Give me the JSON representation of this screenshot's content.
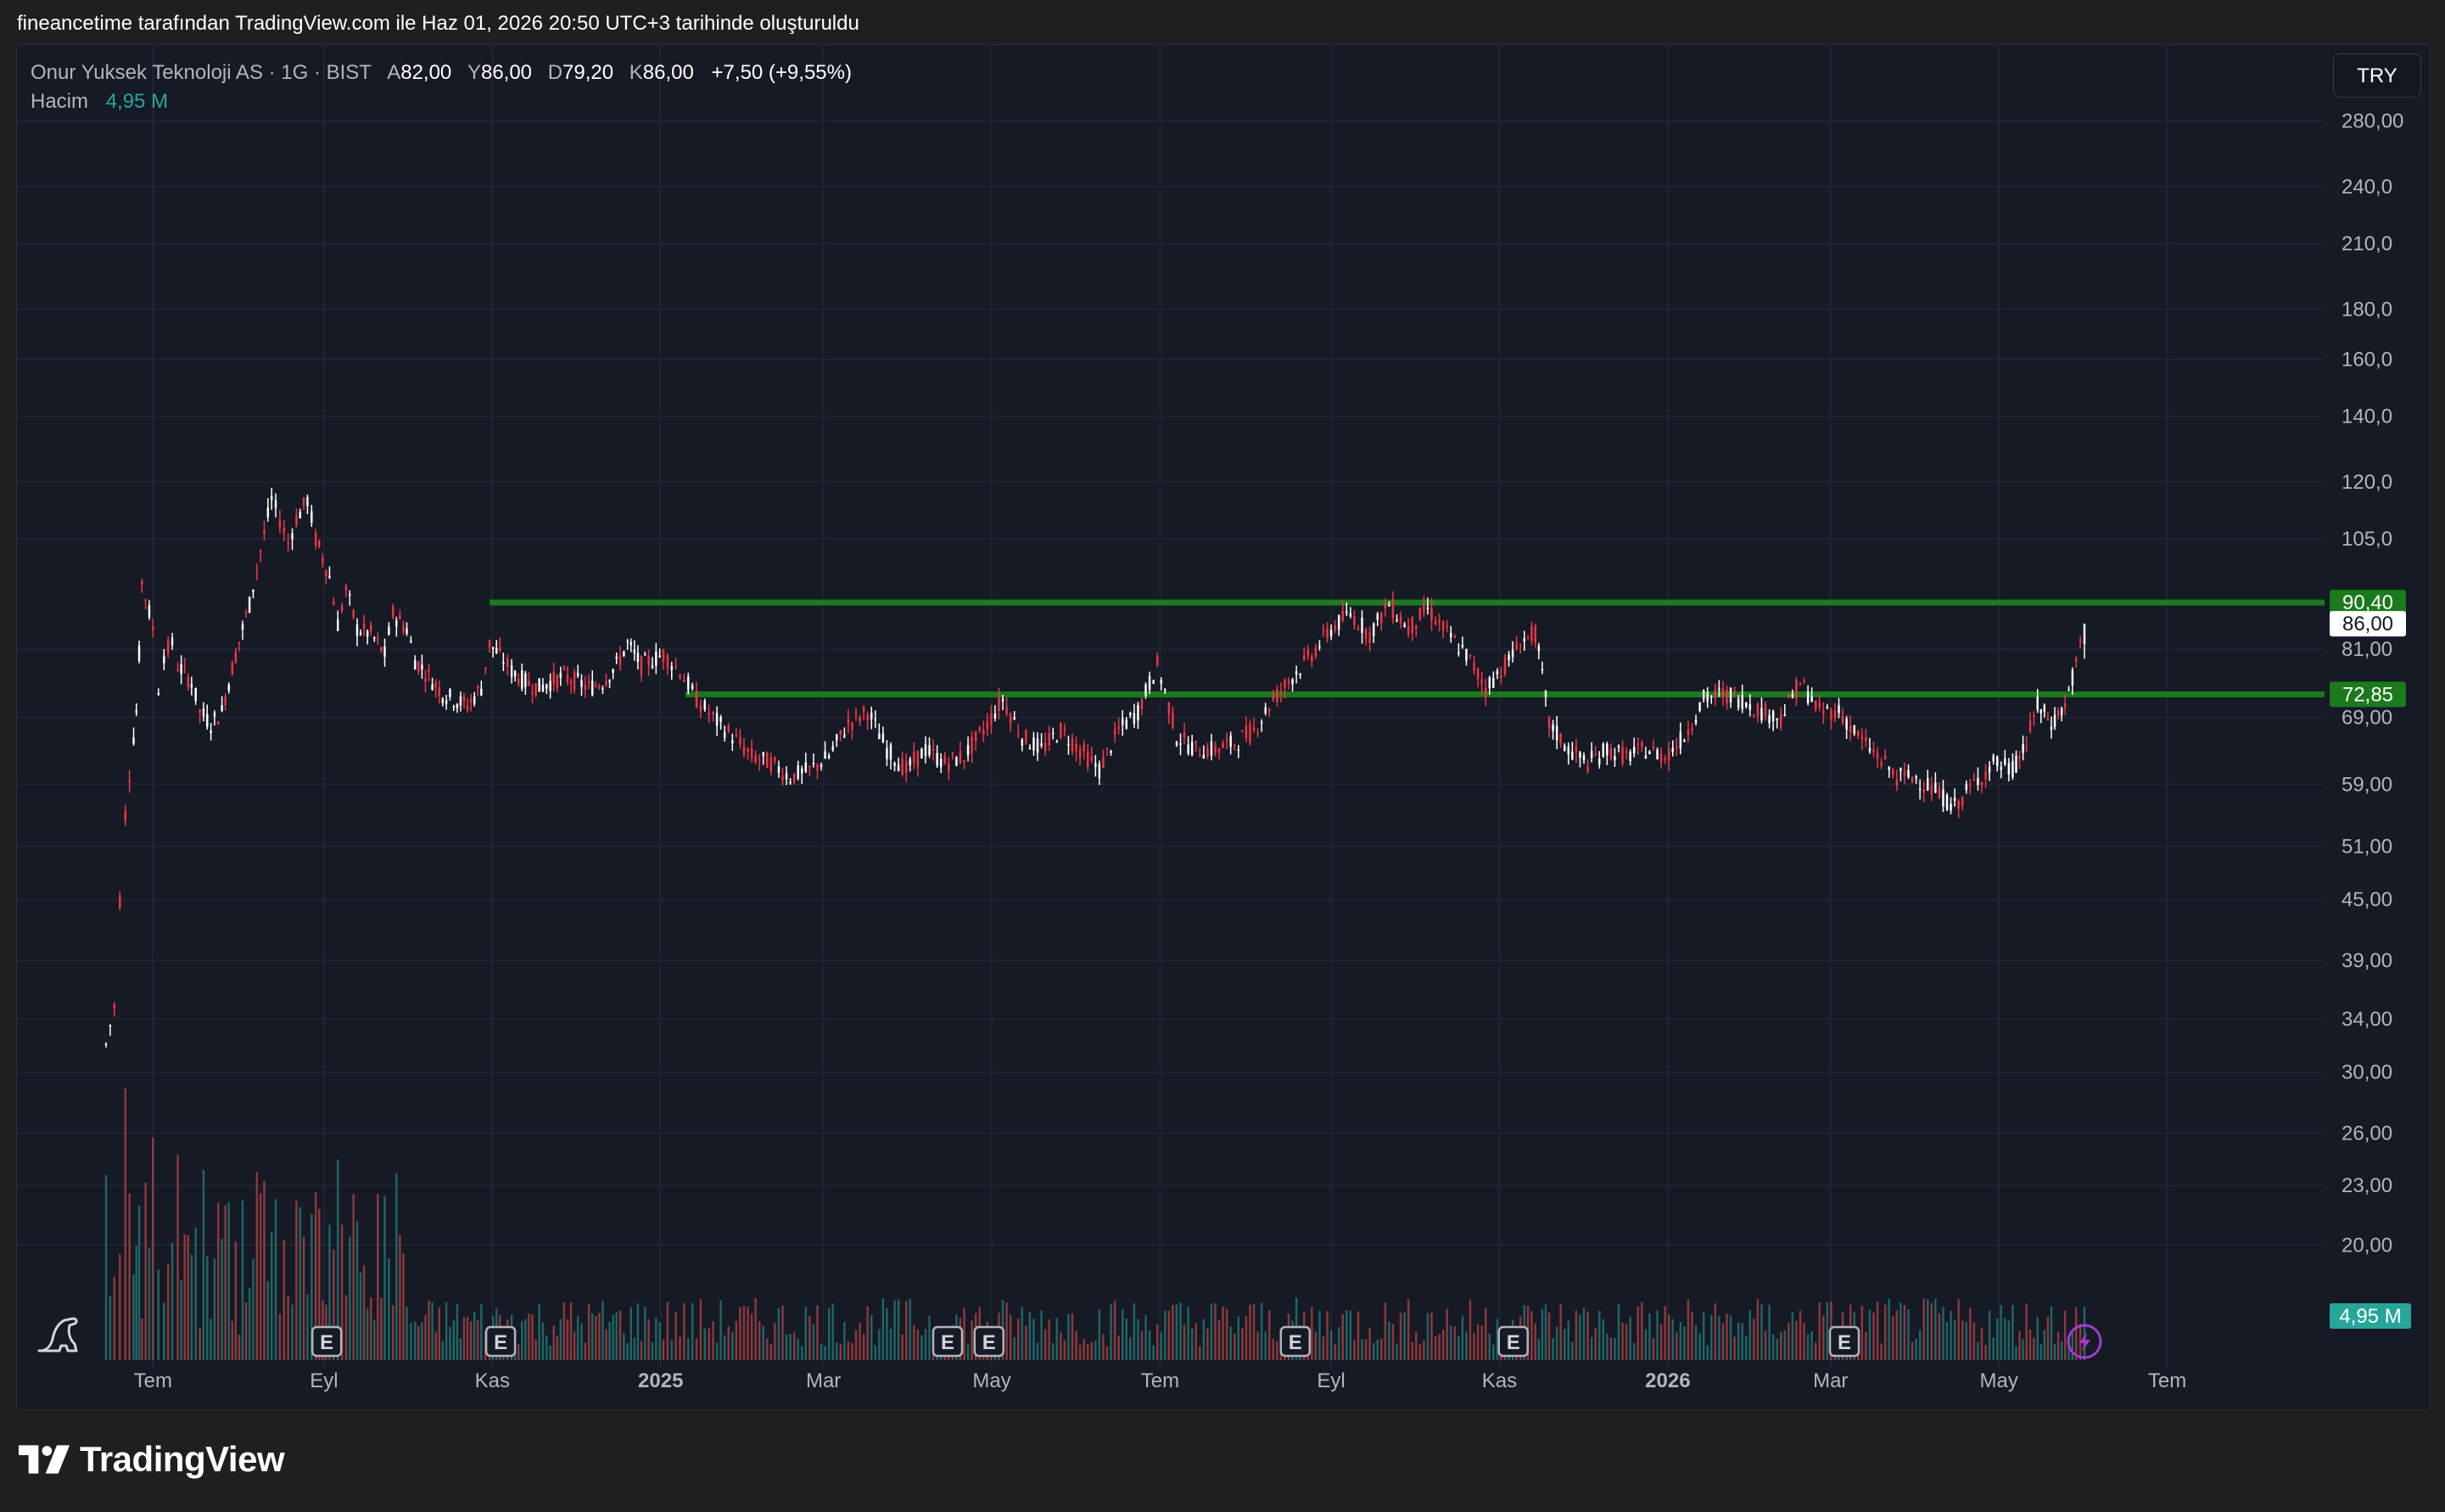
{
  "header": {
    "caption": "fineancetime tarafından TradingView.com ile Haz 01, 2026 20:50 UTC+3 tarihinde oluşturuldu"
  },
  "legend": {
    "symbol": "Onur Yuksek Teknoloji AS · 1G · BIST",
    "open_label": "A",
    "open": "82,00",
    "high_label": "Y",
    "high": "86,00",
    "low_label": "D",
    "low": "79,20",
    "close_label": "K",
    "close": "86,00",
    "change": "+7,50 (+9,55%)",
    "volume_label": "Hacim",
    "volume_value": "4,95 M"
  },
  "currency_button": "TRY",
  "footer": {
    "brand": "TradingView"
  },
  "icons": [
    "tradingview-logo-icon",
    "dino-icon",
    "flash-icon",
    "earnings-marker-icon"
  ],
  "colors": {
    "background": "#161a25",
    "up": "#ffffff",
    "down": "#f23645",
    "level_line": "#1b7a1b",
    "volume_up": "#26a69a",
    "volume_down": "#ef5350",
    "flash": "#a33bd1"
  },
  "chart_data": {
    "type": "candlestick",
    "scale": "log",
    "currency": "TRY",
    "y_ticks": [
      "280,00",
      "240,0",
      "210,0",
      "180,0",
      "160,0",
      "140,0",
      "120,0",
      "105,0",
      "90,40",
      "86,00",
      "81,00",
      "72,85",
      "69,00",
      "59,00",
      "51,00",
      "45,00",
      "39,00",
      "34,00",
      "30,00",
      "26,00",
      "23,00",
      "20,00"
    ],
    "ylim": [
      19,
      290
    ],
    "x_ticks": [
      {
        "label": "Tem",
        "date": "2024-07-01",
        "bold": false
      },
      {
        "label": "Eyl",
        "date": "2024-09-01",
        "bold": false
      },
      {
        "label": "Kas",
        "date": "2024-11-01",
        "bold": false
      },
      {
        "label": "2025",
        "date": "2025-01-01",
        "bold": true
      },
      {
        "label": "Mar",
        "date": "2025-03-01",
        "bold": false
      },
      {
        "label": "May",
        "date": "2025-05-01",
        "bold": false
      },
      {
        "label": "Tem",
        "date": "2025-07-01",
        "bold": false
      },
      {
        "label": "Eyl",
        "date": "2025-09-01",
        "bold": false
      },
      {
        "label": "Kas",
        "date": "2025-11-01",
        "bold": false
      },
      {
        "label": "2026",
        "date": "2026-01-01",
        "bold": true
      },
      {
        "label": "Mar",
        "date": "2026-03-01",
        "bold": false
      },
      {
        "label": "May",
        "date": "2026-05-01",
        "bold": false
      },
      {
        "label": "Tem",
        "date": "2026-07-01",
        "bold": false
      }
    ],
    "price_labels": [
      {
        "text": "90,40",
        "type": "level",
        "value": 90.4
      },
      {
        "text": "86,00",
        "type": "last",
        "value": 86.0
      },
      {
        "text": "72,85",
        "type": "level",
        "value": 72.85
      }
    ],
    "volume_label": "4,95 M",
    "horizontal_levels": [
      {
        "value": 90.4,
        "from": "2024-10-31"
      },
      {
        "value": 72.85,
        "from": "2025-01-10"
      }
    ],
    "earnings_markers": [
      "2024-09-02",
      "2024-11-04",
      "2025-04-15",
      "2025-04-30",
      "2025-08-19",
      "2025-11-06",
      "2026-03-06"
    ],
    "series": [
      {
        "points": [
          [
            "2024-06-14",
            32
          ],
          [
            "2024-06-17",
            35
          ],
          [
            "2024-06-19",
            45
          ],
          [
            "2024-06-21",
            55
          ],
          [
            "2024-06-24",
            66
          ],
          [
            "2024-06-25",
            70
          ],
          [
            "2024-06-26",
            80
          ],
          [
            "2024-06-27",
            95
          ],
          [
            "2024-07-01",
            85
          ],
          [
            "2024-07-03",
            74
          ],
          [
            "2024-07-05",
            80
          ],
          [
            "2024-07-08",
            82
          ],
          [
            "2024-07-10",
            78
          ],
          [
            "2024-07-15",
            75
          ],
          [
            "2024-07-18",
            70
          ],
          [
            "2024-07-22",
            68
          ],
          [
            "2024-07-26",
            70
          ],
          [
            "2024-07-31",
            80
          ],
          [
            "2024-08-05",
            90
          ],
          [
            "2024-08-09",
            102
          ],
          [
            "2024-08-13",
            115
          ],
          [
            "2024-08-16",
            110
          ],
          [
            "2024-08-19",
            104
          ],
          [
            "2024-08-22",
            110
          ],
          [
            "2024-08-26",
            115
          ],
          [
            "2024-08-29",
            105
          ],
          [
            "2024-09-03",
            96
          ],
          [
            "2024-09-06",
            86
          ],
          [
            "2024-09-09",
            93
          ],
          [
            "2024-09-13",
            85
          ],
          [
            "2024-09-18",
            84
          ],
          [
            "2024-09-23",
            80
          ],
          [
            "2024-09-26",
            88
          ],
          [
            "2024-10-01",
            85
          ],
          [
            "2024-10-04",
            79
          ],
          [
            "2024-10-09",
            76
          ],
          [
            "2024-10-14",
            73
          ],
          [
            "2024-10-18",
            72
          ],
          [
            "2024-10-23",
            71
          ],
          [
            "2024-10-28",
            74
          ],
          [
            "2024-10-31",
            82
          ],
          [
            "2024-11-05",
            79
          ],
          [
            "2024-11-08",
            77
          ],
          [
            "2024-11-13",
            75
          ],
          [
            "2024-11-18",
            74
          ],
          [
            "2024-11-22",
            75
          ],
          [
            "2024-11-27",
            76
          ],
          [
            "2024-12-02",
            75
          ],
          [
            "2024-12-06",
            74
          ],
          [
            "2024-12-11",
            75
          ],
          [
            "2024-12-16",
            78
          ],
          [
            "2024-12-20",
            82
          ],
          [
            "2024-12-25",
            78
          ],
          [
            "2025-01-02",
            80
          ],
          [
            "2025-01-08",
            77
          ],
          [
            "2025-01-14",
            72
          ],
          [
            "2025-01-20",
            69
          ],
          [
            "2025-01-27",
            66
          ],
          [
            "2025-02-03",
            63
          ],
          [
            "2025-02-10",
            62
          ],
          [
            "2025-02-17",
            60
          ],
          [
            "2025-02-24",
            61
          ],
          [
            "2025-03-03",
            63
          ],
          [
            "2025-03-10",
            68
          ],
          [
            "2025-03-17",
            70
          ],
          [
            "2025-03-24",
            64
          ],
          [
            "2025-03-31",
            61
          ],
          [
            "2025-04-07",
            64
          ],
          [
            "2025-04-14",
            62
          ],
          [
            "2025-04-21",
            63
          ],
          [
            "2025-04-28",
            67
          ],
          [
            "2025-05-05",
            72
          ],
          [
            "2025-05-12",
            66
          ],
          [
            "2025-05-19",
            64
          ],
          [
            "2025-05-26",
            67
          ],
          [
            "2025-06-02",
            64
          ],
          [
            "2025-06-09",
            61
          ],
          [
            "2025-06-16",
            67
          ],
          [
            "2025-06-23",
            70
          ],
          [
            "2025-06-30",
            78
          ],
          [
            "2025-07-07",
            66
          ],
          [
            "2025-07-14",
            64
          ],
          [
            "2025-07-21",
            64
          ],
          [
            "2025-07-28",
            65
          ],
          [
            "2025-08-04",
            67
          ],
          [
            "2025-08-11",
            72
          ],
          [
            "2025-08-18",
            76
          ],
          [
            "2025-08-25",
            80
          ],
          [
            "2025-09-01",
            85
          ],
          [
            "2025-09-08",
            88
          ],
          [
            "2025-09-15",
            84
          ],
          [
            "2025-09-22",
            90
          ],
          [
            "2025-09-29",
            85
          ],
          [
            "2025-10-06",
            89
          ],
          [
            "2025-10-13",
            84
          ],
          [
            "2025-10-20",
            80
          ],
          [
            "2025-10-27",
            74
          ],
          [
            "2025-11-03",
            78
          ],
          [
            "2025-11-10",
            83
          ],
          [
            "2025-11-14",
            84
          ],
          [
            "2025-11-19",
            68
          ],
          [
            "2025-11-26",
            64
          ],
          [
            "2025-12-03",
            62
          ],
          [
            "2025-12-10",
            64
          ],
          [
            "2025-12-17",
            63
          ],
          [
            "2025-12-24",
            64
          ],
          [
            "2025-12-31",
            63
          ],
          [
            "2026-01-07",
            66
          ],
          [
            "2026-01-14",
            72
          ],
          [
            "2026-01-21",
            73
          ],
          [
            "2026-01-28",
            72
          ],
          [
            "2026-02-04",
            70
          ],
          [
            "2026-02-11",
            69
          ],
          [
            "2026-02-18",
            75
          ],
          [
            "2026-02-25",
            70
          ],
          [
            "2026-03-04",
            70
          ],
          [
            "2026-03-11",
            66
          ],
          [
            "2026-03-18",
            63
          ],
          [
            "2026-03-25",
            60
          ],
          [
            "2026-04-01",
            60
          ],
          [
            "2026-04-08",
            58
          ],
          [
            "2026-04-15",
            56
          ],
          [
            "2026-04-22",
            59
          ],
          [
            "2026-04-29",
            62
          ],
          [
            "2026-05-06",
            61
          ],
          [
            "2026-05-11",
            65
          ],
          [
            "2026-05-15",
            71
          ],
          [
            "2026-05-20",
            68
          ],
          [
            "2026-05-25",
            71
          ],
          [
            "2026-05-29",
            78
          ],
          [
            "2026-06-01",
            86
          ]
        ]
      }
    ]
  }
}
